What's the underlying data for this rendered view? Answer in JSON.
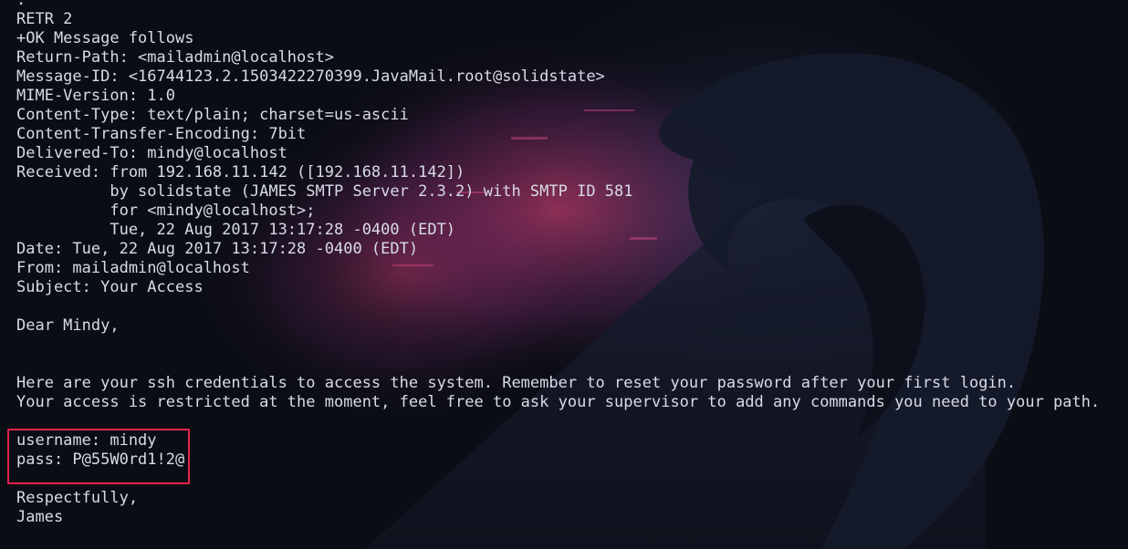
{
  "terminal": {
    "lines": [
      ".",
      "RETR 2",
      "+OK Message follows",
      "Return-Path: <mailadmin@localhost>",
      "Message-ID: <16744123.2.1503422270399.JavaMail.root@solidstate>",
      "MIME-Version: 1.0",
      "Content-Type: text/plain; charset=us-ascii",
      "Content-Transfer-Encoding: 7bit",
      "Delivered-To: mindy@localhost",
      "Received: from 192.168.11.142 ([192.168.11.142])",
      "          by solidstate (JAMES SMTP Server 2.3.2) with SMTP ID 581",
      "          for <mindy@localhost>;",
      "          Tue, 22 Aug 2017 13:17:28 -0400 (EDT)",
      "Date: Tue, 22 Aug 2017 13:17:28 -0400 (EDT)",
      "From: mailadmin@localhost",
      "Subject: Your Access",
      "",
      "Dear Mindy,",
      "",
      "",
      "Here are your ssh credentials to access the system. Remember to reset your password after your first login.",
      "Your access is restricted at the moment, feel free to ask your supervisor to add any commands you need to your path.",
      "",
      "username: mindy",
      "pass: P@55W0rd1!2@",
      "",
      "Respectfully,",
      "James"
    ]
  },
  "colors": {
    "background": "#0b0d15",
    "text": "#d8dbe8",
    "highlight_border": "#e0234a"
  }
}
